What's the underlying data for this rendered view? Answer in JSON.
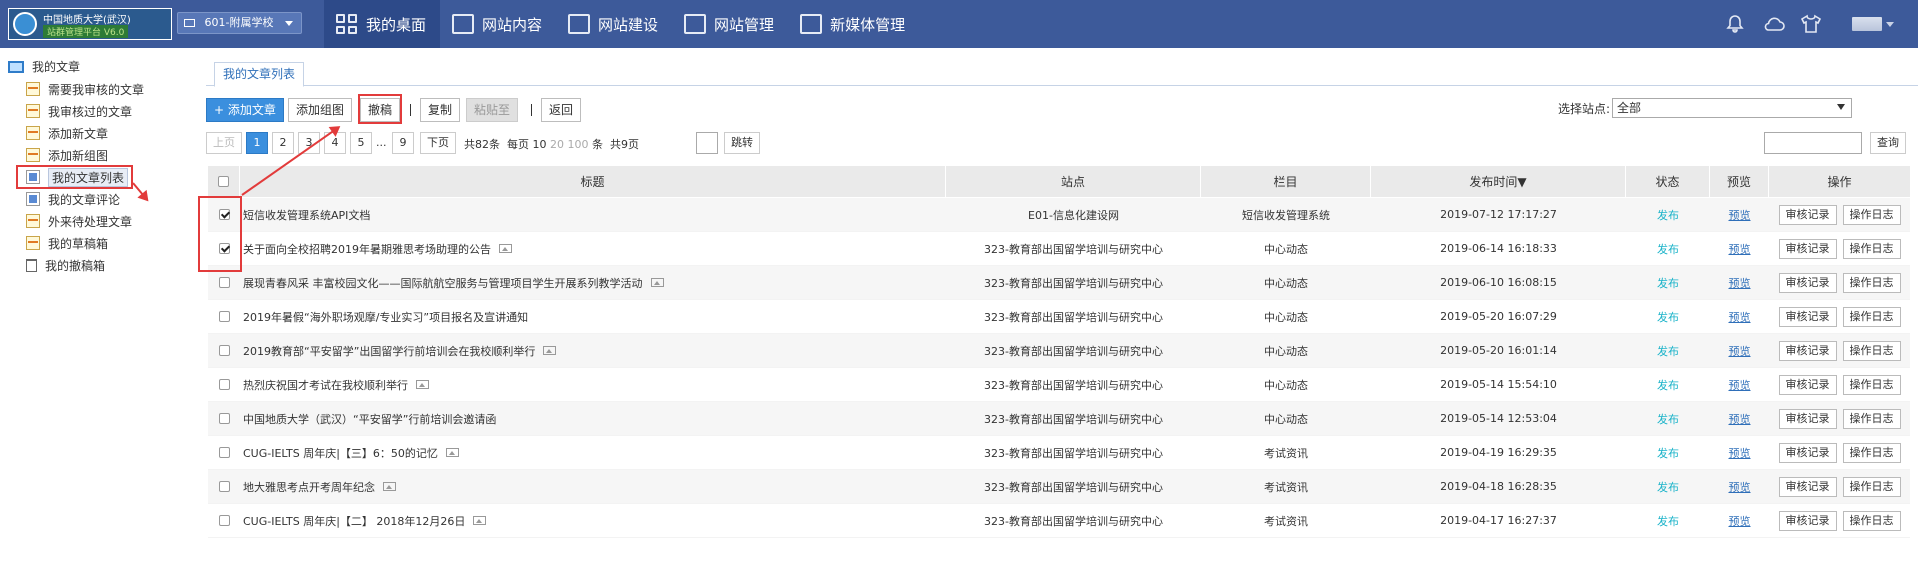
{
  "header": {
    "logo_line1": "中国地质大学(武汉)",
    "logo_line2": "站群管理平台 V6.0",
    "site_switch": "601-附属学校",
    "nav": [
      {
        "label": "我的桌面",
        "icon": "dashboard-icon"
      },
      {
        "label": "网站内容",
        "icon": "edit-icon"
      },
      {
        "label": "网站建设",
        "icon": "add-page-icon"
      },
      {
        "label": "网站管理",
        "icon": "settings-monitor-icon"
      },
      {
        "label": "新媒体管理",
        "icon": "media-icon"
      }
    ],
    "right_icons": [
      "bell-icon",
      "cloud-icon",
      "shirt-icon",
      "user-avatar-icon"
    ]
  },
  "sidebar": {
    "root": "我的文章",
    "items": [
      {
        "label": "需要我审核的文章"
      },
      {
        "label": "我审核过的文章"
      },
      {
        "label": "添加新文章"
      },
      {
        "label": "添加新组图"
      },
      {
        "label": "我的文章列表"
      },
      {
        "label": "我的文章评论"
      },
      {
        "label": "外来待处理文章"
      },
      {
        "label": "我的草稿箱"
      },
      {
        "label": "我的撤稿箱"
      }
    ]
  },
  "tab": {
    "label": "我的文章列表"
  },
  "toolbar": {
    "add_article": "+ 添加文章",
    "add_gallery": "添加组图",
    "withdraw": "撤稿",
    "copy": "复制",
    "paste_to": "粘贴至",
    "back": "返回",
    "site_label": "选择站点:",
    "site_value": "全部",
    "search_btn": "查询"
  },
  "pagination": {
    "prev": "上页",
    "pages": [
      "1",
      "2",
      "3",
      "4",
      "5"
    ],
    "ellipsis": "...",
    "last": "9",
    "next": "下页",
    "total_text": "共82条",
    "per_page_label": "每页",
    "per_page_10": "10",
    "per_page_20": "20",
    "per_page_100": "100",
    "per_page_suffix": "条",
    "page_total": "共9页",
    "jump": "跳转"
  },
  "table": {
    "headers": {
      "title": "标题",
      "site": "站点",
      "column": "栏目",
      "publish_time": "发布时间▼",
      "status": "状态",
      "preview": "预览",
      "actions": "操作"
    },
    "action_labels": {
      "audit": "审核记录",
      "log": "操作日志"
    },
    "rows": [
      {
        "checked": true,
        "title": "短信收发管理系统API文档",
        "has_image": false,
        "site": "E01-信息化建设网",
        "column": "短信收发管理系统",
        "time": "2019-07-12 17:17:27",
        "status": "发布",
        "preview": "预览"
      },
      {
        "checked": true,
        "title": "关于面向全校招聘2019年暑期雅思考场助理的公告",
        "has_image": true,
        "site": "323-教育部出国留学培训与研究中心",
        "column": "中心动态",
        "time": "2019-06-14 16:18:33",
        "status": "发布",
        "preview": "预览"
      },
      {
        "checked": false,
        "title": "展现青春风采 丰富校园文化——国际航航空服务与管理项目学生开展系列教学活动",
        "has_image": true,
        "site": "323-教育部出国留学培训与研究中心",
        "column": "中心动态",
        "time": "2019-06-10 16:08:15",
        "status": "发布",
        "preview": "预览"
      },
      {
        "checked": false,
        "title": "2019年暑假“海外职场观摩/专业实习”项目报名及宣讲通知",
        "has_image": false,
        "site": "323-教育部出国留学培训与研究中心",
        "column": "中心动态",
        "time": "2019-05-20 16:07:29",
        "status": "发布",
        "preview": "预览"
      },
      {
        "checked": false,
        "title": "2019教育部“平安留学”出国留学行前培训会在我校顺利举行",
        "has_image": true,
        "site": "323-教育部出国留学培训与研究中心",
        "column": "中心动态",
        "time": "2019-05-20 16:01:14",
        "status": "发布",
        "preview": "预览"
      },
      {
        "checked": false,
        "title": "热烈庆祝国才考试在我校顺利举行",
        "has_image": true,
        "site": "323-教育部出国留学培训与研究中心",
        "column": "中心动态",
        "time": "2019-05-14 15:54:10",
        "status": "发布",
        "preview": "预览"
      },
      {
        "checked": false,
        "title": "中国地质大学（武汉）“平安留学”行前培训会邀请函",
        "has_image": false,
        "site": "323-教育部出国留学培训与研究中心",
        "column": "中心动态",
        "time": "2019-05-14 12:53:04",
        "status": "发布",
        "preview": "预览"
      },
      {
        "checked": false,
        "title": "CUG-IELTS 周年庆|【三】6：50的记忆",
        "has_image": true,
        "site": "323-教育部出国留学培训与研究中心",
        "column": "考试资讯",
        "time": "2019-04-19 16:29:35",
        "status": "发布",
        "preview": "预览"
      },
      {
        "checked": false,
        "title": "地大雅思考点开考周年纪念",
        "has_image": true,
        "site": "323-教育部出国留学培训与研究中心",
        "column": "考试资讯",
        "time": "2019-04-18 16:28:35",
        "status": "发布",
        "preview": "预览"
      },
      {
        "checked": false,
        "title": "CUG-IELTS 周年庆|【二】 2018年12月26日",
        "has_image": true,
        "site": "323-教育部出国留学培训与研究中心",
        "column": "考试资讯",
        "time": "2019-04-17 16:27:37",
        "status": "发布",
        "preview": "预览"
      }
    ]
  }
}
